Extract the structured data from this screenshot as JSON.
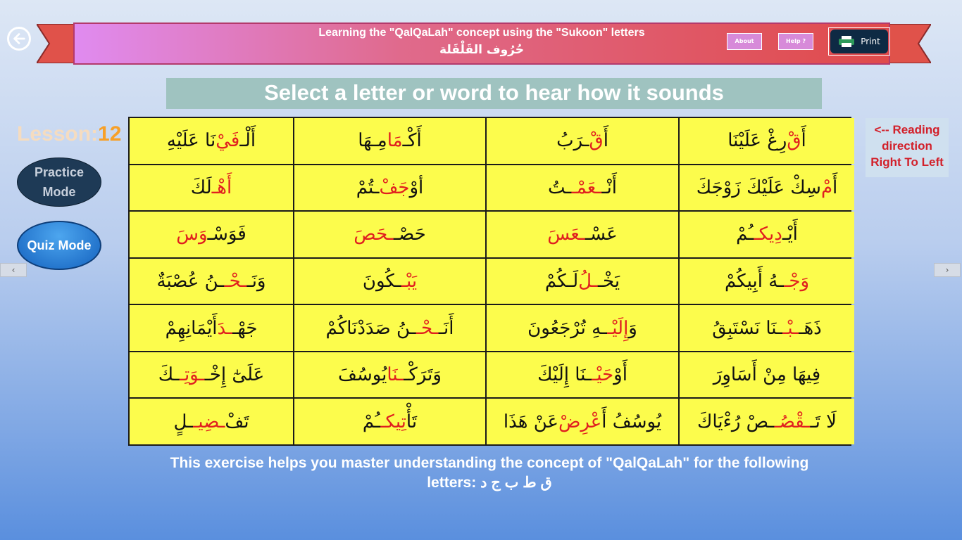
{
  "header": {
    "title": "Learning the \"QalQaLah\" concept using the \"Sukoon\" letters",
    "arabic_title": "حُرُوف القَلْقَلة",
    "about_label": "About",
    "help_label": "Help ?",
    "print_label": "Print"
  },
  "instruction": "Select a letter or word to hear how it sounds",
  "lesson": {
    "label": "Lesson:",
    "number": "12"
  },
  "modes": {
    "practice": "Practice Mode",
    "quiz": "Quiz Mode"
  },
  "reading_direction": {
    "line1": "<-- Reading",
    "line2": "direction",
    "line3": "Right To Left"
  },
  "scroll": {
    "left": "‹",
    "right": "›"
  },
  "grid": {
    "rows": [
      [
        {
          "pre": "أَ",
          "hl": "قْ",
          "post": "رِغْ عَلَيْنَا"
        },
        {
          "pre": "أَ",
          "hl": "قْ",
          "post": "ـرَبُ"
        },
        {
          "pre": "أَكْـ",
          "hl": "مَا",
          "post": "مِـهَا"
        },
        {
          "pre": "أَلْـ",
          "hl": "فَيْ",
          "post": "نَا عَلَيْهِ"
        }
      ],
      [
        {
          "pre": "أَ",
          "hl": "مْ",
          "post": "سِكْ عَلَيْكَ زَوْجَكَ"
        },
        {
          "pre": "أَنْـ",
          "hl": "ـعَمْـ",
          "post": "ـتُ"
        },
        {
          "pre": "أوْ",
          "hl": "جَفْ",
          "post": "ـتُمْ"
        },
        {
          "pre": "",
          "hl": "أَهْـ",
          "post": "لَكَ"
        }
      ],
      [
        {
          "pre": "أَيْـ",
          "hl": "دِيكـ",
          "post": "ـُمْ"
        },
        {
          "pre": "عَسْـ",
          "hl": "ـعَسَ",
          "post": ""
        },
        {
          "pre": "حَصْـ",
          "hl": "ـحَصَ",
          "post": ""
        },
        {
          "pre": "فَوَسْـ",
          "hl": "وَسَ",
          "post": ""
        }
      ],
      [
        {
          "pre": "",
          "hl": "وَجْـ",
          "post": "ـهُ أَبِيكُمْ"
        },
        {
          "pre": "يَخْـ",
          "hl": "ـلُ",
          "post": " لَـكُمْ"
        },
        {
          "pre": "",
          "hl": "يَبْـ",
          "post": "ـكُونَ"
        },
        {
          "pre": "وَنَـ",
          "hl": "ـحْـ",
          "post": "ـنُ عُصْبَةٌ"
        }
      ],
      [
        {
          "pre": "ذَهَـ",
          "hl": "ـبْـ",
          "post": "ـنَا نَسْتَبِقُ"
        },
        {
          "pre": "وَ",
          "hl": "إِلَيْـ",
          "post": "ـهِ تُرْجَعُونَ"
        },
        {
          "pre": "أَنَـ",
          "hl": "ـحْـ",
          "post": "ـنُ صَدَدْنَاكُمْ"
        },
        {
          "pre": "جَهْـ",
          "hl": "ـدَ",
          "post": " أَيْمَانِهِمْ"
        }
      ],
      [
        {
          "pre": "فِيهَا مِنْ أَسَاوِرَ",
          "hl": "",
          "post": ""
        },
        {
          "pre": "أَوْ",
          "hl": "حَيْـ",
          "post": "ـنَا إِلَيْكَ"
        },
        {
          "pre": "وَتَرَكْـ",
          "hl": "ـنَا",
          "post": " يُوسُفَ"
        },
        {
          "pre": "عَلَىٰٓ إِخْـ",
          "hl": "ـوَتِـ",
          "post": "ـكَ"
        }
      ],
      [
        {
          "pre": "لَا تَـ",
          "hl": "ـقْصُـ",
          "post": "ـصْ رُءْيَاكَ"
        },
        {
          "pre": "يُوسُفُ أَ",
          "hl": "عْرِضْ",
          "post": " عَنْ هَذَا"
        },
        {
          "pre": "تَأْ",
          "hl": "تِيكـ",
          "post": "ـُمْ"
        },
        {
          "pre": "تَفْ",
          "hl": "ـضِيـ",
          "post": "ـلٍ"
        }
      ]
    ]
  },
  "footer": {
    "line1": "This exercise helps you master understanding the concept of \"QalQaLah\" for the following",
    "line2": "letters: ق ط ب ج د"
  },
  "colors": {
    "highlight": "#e01f1f",
    "cell_bg": "#fcfc4c"
  }
}
